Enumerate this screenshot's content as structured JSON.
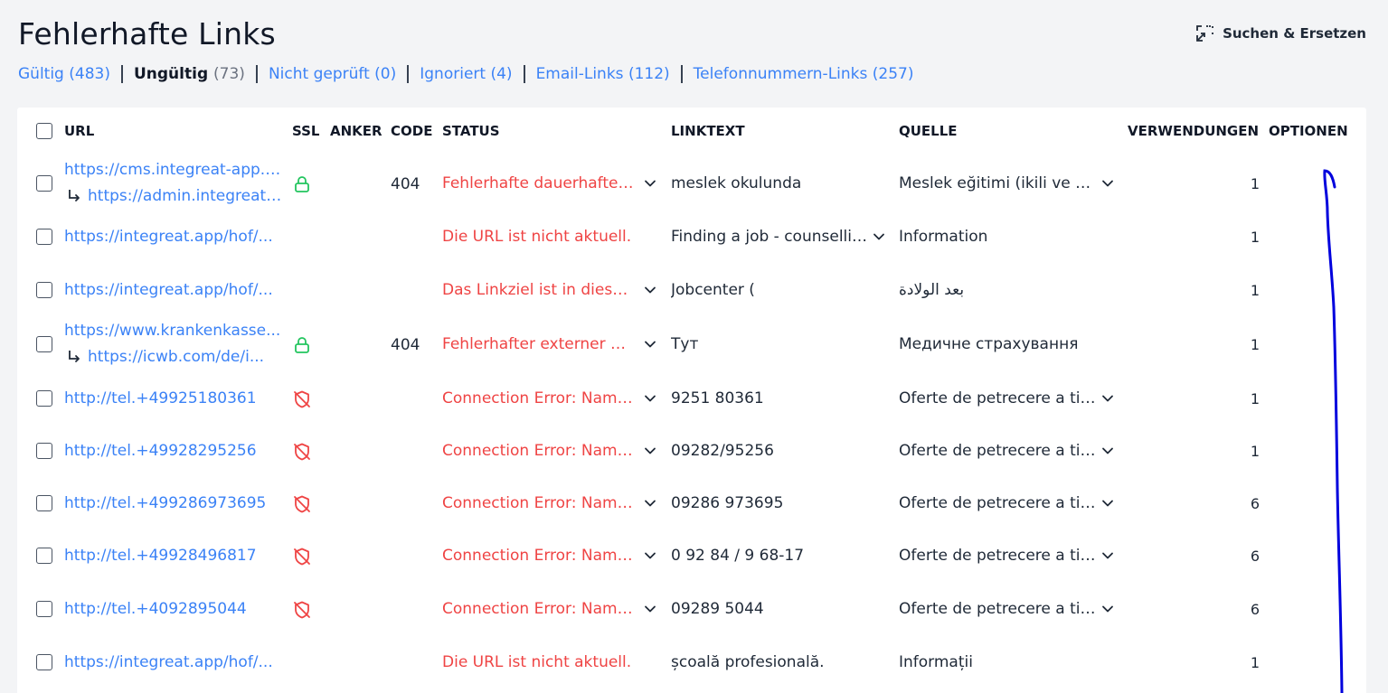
{
  "page": {
    "title": "Fehlerhafte Links"
  },
  "toolbar": {
    "search_replace_label": "Suchen & Ersetzen"
  },
  "filters": [
    {
      "label": "Gültig",
      "count": "(483)",
      "active": false
    },
    {
      "label": "Ungültig",
      "count": "(73)",
      "active": true
    },
    {
      "label": "Nicht geprüft",
      "count": "(0)",
      "active": false
    },
    {
      "label": "Ignoriert",
      "count": "(4)",
      "active": false
    },
    {
      "label": "Email-Links",
      "count": "(112)",
      "active": false
    },
    {
      "label": "Telefonnummern-Links",
      "count": "(257)",
      "active": false
    }
  ],
  "table": {
    "headers": {
      "url": "URL",
      "ssl": "SSL",
      "anchor": "ANKER",
      "code": "CODE",
      "status": "STATUS",
      "linktext": "LINKTEXT",
      "source": "QUELLE",
      "uses": "VERWENDUNGEN",
      "options": "OPTIONEN"
    },
    "rows": [
      {
        "url": "https://cms.integreat-app.de/...",
        "redirect": "https://admin.integreat-app.de/...",
        "ssl": "lock",
        "code": "404",
        "status": "Fehlerhafte dauerhafte Weiterleitung",
        "status_dd": true,
        "linktext": "meslek okulunda",
        "linktext_dd": false,
        "source": "Meslek eğitimi (ikili ve tam zamanlı)",
        "source_dd": true,
        "uses": "1"
      },
      {
        "url": "https://integreat.app/hof/...",
        "redirect": "",
        "ssl": "",
        "code": "",
        "status": "Die URL ist nicht aktuell.",
        "status_dd": false,
        "linktext": "Finding a job - counselling",
        "linktext_dd": true,
        "source": "Information",
        "source_dd": false,
        "uses": "1"
      },
      {
        "url": "https://integreat.app/hof/...",
        "redirect": "",
        "ssl": "",
        "code": "",
        "status": "Das Linkziel ist in dieser Sprache nicht verfügbar.",
        "status_dd": true,
        "linktext": "Jobcenter (",
        "linktext_dd": false,
        "source": "بعد الولادة",
        "source_dd": false,
        "uses": "1"
      },
      {
        "url": "https://www.krankenkasse...",
        "redirect": "https://icwb.com/de/i...",
        "ssl": "lock",
        "code": "404",
        "status": "Fehlerhafter externer Link",
        "status_dd": true,
        "linktext": "Тут",
        "linktext_dd": false,
        "source": "Медичне страхування",
        "source_dd": false,
        "uses": "1"
      },
      {
        "url": "http://tel.+49925180361",
        "redirect": "",
        "ssl": "shield-off",
        "code": "",
        "status": "Connection Error: Name or service not known",
        "status_dd": true,
        "linktext": " 9251 80361",
        "linktext_dd": false,
        "source": "Oferte de petrecere a timpului liber",
        "source_dd": true,
        "uses": "1"
      },
      {
        "url": "http://tel.+49928295256",
        "redirect": "",
        "ssl": "shield-off",
        "code": "",
        "status": "Connection Error: Name or service not known",
        "status_dd": true,
        "linktext": "09282/95256",
        "linktext_dd": false,
        "source": "Oferte de petrecere a timpului liber",
        "source_dd": true,
        "uses": "1"
      },
      {
        "url": "http://tel.+499286973695",
        "redirect": "",
        "ssl": "shield-off",
        "code": "",
        "status": "Connection Error: Name or service not known",
        "status_dd": true,
        "linktext": "09286 973695",
        "linktext_dd": false,
        "source": "Oferte de petrecere a timpului liber",
        "source_dd": true,
        "uses": "6"
      },
      {
        "url": "http://tel.+49928496817",
        "redirect": "",
        "ssl": "shield-off",
        "code": "",
        "status": "Connection Error: Name or service not known",
        "status_dd": true,
        "linktext": "0 92 84 / 9 68-17",
        "linktext_dd": false,
        "source": "Oferte de petrecere a timpului liber",
        "source_dd": true,
        "uses": "6"
      },
      {
        "url": "http://tel.+4092895044",
        "redirect": "",
        "ssl": "shield-off",
        "code": "",
        "status": "Connection Error: Name or service not known",
        "status_dd": true,
        "linktext": "09289 5044",
        "linktext_dd": false,
        "source": "Oferte de petrecere a timpului liber",
        "source_dd": true,
        "uses": "6"
      },
      {
        "url": "https://integreat.app/hof/...",
        "redirect": "",
        "ssl": "",
        "code": "",
        "status": "Die URL ist nicht aktuell.",
        "status_dd": false,
        "linktext": "școală profesională.",
        "linktext_dd": false,
        "source": "Informații",
        "source_dd": false,
        "uses": "1"
      }
    ]
  },
  "colors": {
    "link": "#3b82f6",
    "error": "#ef4444",
    "ssl_ok": "#22c55e",
    "ssl_bad": "#ef4444",
    "annotation": "#0000dd"
  }
}
